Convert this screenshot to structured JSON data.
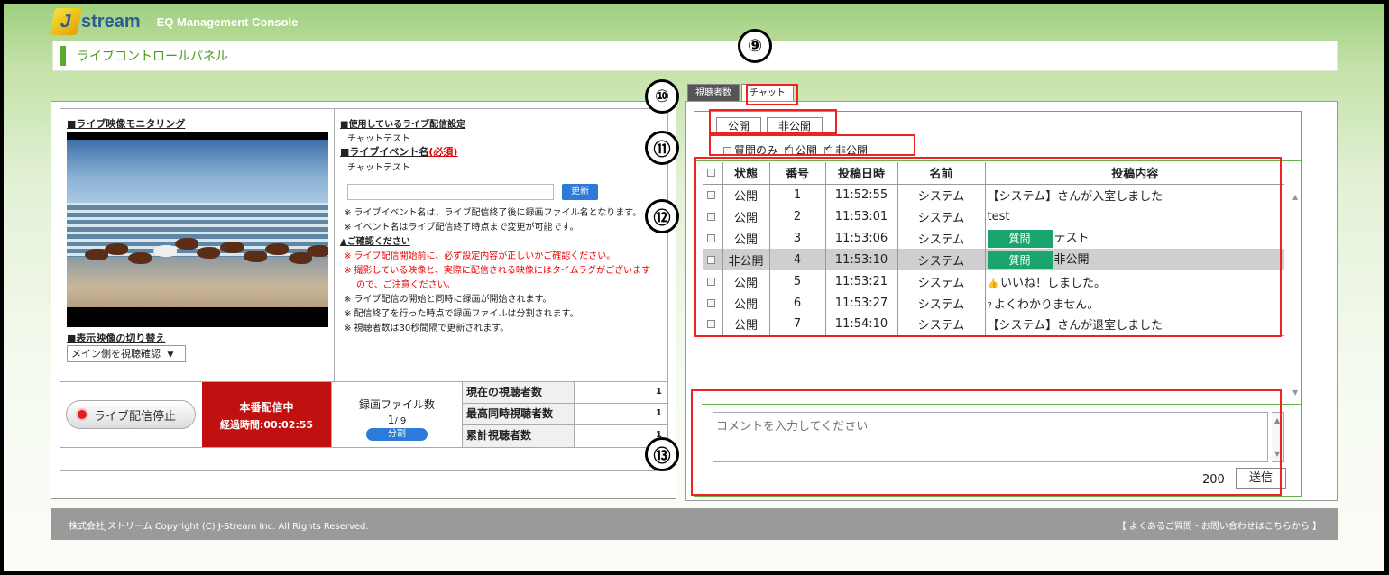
{
  "header": {
    "logo_mark": "J",
    "logo_brand": "stream",
    "console_name": "EQ Management Console",
    "page_title": "ライブコントロールパネル"
  },
  "left": {
    "monitor_title": "■ライブ映像モニタリング",
    "switch_title": "■表示映像の切り替え",
    "switch_select": "メイン側を視聴確認",
    "settings_title": "■使用しているライブ配信設定",
    "settings_value": "チャットテスト",
    "event_title": "■ライブイベント名",
    "event_required": "(必須)",
    "event_value": "チャットテスト",
    "update_button": "更新",
    "note1": "※ ライブイベント名は、ライブ配信終了後に録画ファイル名となります。",
    "note2": "※ イベント名はライブ配信終了時点まで変更が可能です。",
    "confirm_title": "▲ご確認ください",
    "warn1": "※ ライブ配信開始前に、必ず設定内容が正しいかご確認ください。",
    "warn2": "※ 撮影している映像と、実際に配信される映像にはタイムラグがございます",
    "warn2b": "ので、ご注意ください。",
    "info1": "※ ライブ配信の開始と同時に録画が開始されます。",
    "info2": "※ 配信終了を行った時点で録画ファイルは分割されます。",
    "info3": "※ 視聴者数は30秒間隔で更新されます。",
    "stop_button": "ライブ配信停止",
    "on_air": "本番配信中",
    "elapsed": "経過時間:00:02:55",
    "rec_label": "録画ファイル数",
    "rec_current": "1",
    "rec_total": "/ 9",
    "split_button": "分割",
    "viewers": [
      {
        "label": "現在の視聴者数",
        "value": "1"
      },
      {
        "label": "最高同時視聴者数",
        "value": "1"
      },
      {
        "label": "累計視聴者数",
        "value": "1"
      }
    ]
  },
  "right": {
    "tabs": [
      "視聴者数",
      "チャット"
    ],
    "public_button": "公開",
    "private_button": "非公開",
    "filters": [
      {
        "label": "質問のみ",
        "checked": false
      },
      {
        "label": "公開",
        "checked": true
      },
      {
        "label": "非公開",
        "checked": true
      }
    ],
    "columns": [
      "状態",
      "番号",
      "投稿日時",
      "名前",
      "投稿内容"
    ],
    "rows": [
      {
        "status": "公開",
        "no": "1",
        "time": "11:52:55",
        "name": "システム",
        "badge": "",
        "icon": "",
        "text": "【システム】さんが入室しました"
      },
      {
        "status": "公開",
        "no": "2",
        "time": "11:53:01",
        "name": "システム",
        "badge": "",
        "icon": "",
        "text": "test"
      },
      {
        "status": "公開",
        "no": "3",
        "time": "11:53:06",
        "name": "システム",
        "badge": "質問",
        "icon": "",
        "text": "テスト"
      },
      {
        "status": "非公開",
        "no": "4",
        "time": "11:53:10",
        "name": "システム",
        "badge": "質問",
        "icon": "",
        "text": "非公開"
      },
      {
        "status": "公開",
        "no": "5",
        "time": "11:53:21",
        "name": "システム",
        "badge": "",
        "icon": "👍",
        "text": "いいね！しました。"
      },
      {
        "status": "公開",
        "no": "6",
        "time": "11:53:27",
        "name": "システム",
        "badge": "",
        "icon": "?",
        "text": "よくわかりません。"
      },
      {
        "status": "公開",
        "no": "7",
        "time": "11:54:10",
        "name": "システム",
        "badge": "",
        "icon": "",
        "text": "【システム】さんが退室しました"
      }
    ],
    "comment_placeholder": "コメントを入力してください",
    "char_count": "200",
    "send_button": "送信"
  },
  "annotations": [
    "⑨",
    "⑩",
    "⑪",
    "⑫",
    "⑬"
  ],
  "footer": {
    "copyright": "株式会社Jストリーム Copyright (C) J-Stream Inc. All Rights Reserved.",
    "faq_link": "【 よくあるご質問・お問い合わせはこちらから 】"
  }
}
